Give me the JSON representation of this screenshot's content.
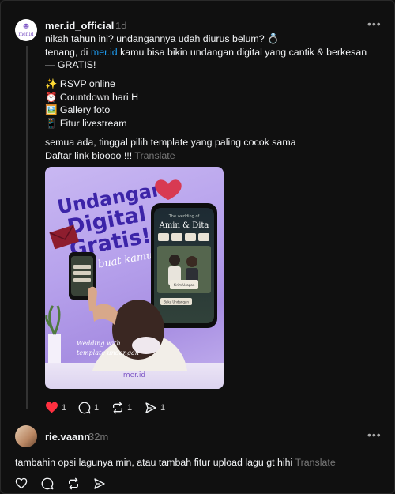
{
  "post": {
    "username": "mer.id_official",
    "time": "1d",
    "avatar_text": "mer.id",
    "lines": {
      "l1": "nikah tahun ini? undangannya udah diurus belum? 💍",
      "l2_pre": "tenang, di ",
      "l2_link": "mer.id",
      "l2_post": " kamu bisa bikin undangan digital yang cantik & berkesan",
      "l3": "— GRATIS!",
      "f1": "✨ RSVP online",
      "f2": "⏰ Countdown hari H",
      "f3": "🖼️ Gallery foto",
      "f4": "📱 Fitur livestream",
      "c1": "semua ada, tinggal pilih template yang paling cocok sama",
      "c2": "Daftar link bioooo !!!",
      "translate": "Translate"
    },
    "image": {
      "headline1": "Undangan",
      "headline2": "Digital",
      "headline3": "Gratis!",
      "subline": "buat kamu",
      "phone_tagline": "The wedding of",
      "phone_names": "Amin & Dita",
      "phone_button": "Buka Undangan",
      "phone_small_label": "Kirim Ucapan",
      "script_text1": "Wedding with",
      "script_text2": "template undangan",
      "watermark": "mer.id"
    },
    "actions": {
      "likes": "1",
      "comments": "1",
      "reposts": "1",
      "shares": "1"
    }
  },
  "reply": {
    "username": "rie.vaann",
    "time": "32m",
    "text": "tambahin opsi lagunya min, atau tambah fitur upload lagu gt hihi",
    "translate": "Translate"
  },
  "colors": {
    "like": "#ff3040",
    "link": "#1d9bf0",
    "brand": "#7b53c4"
  }
}
